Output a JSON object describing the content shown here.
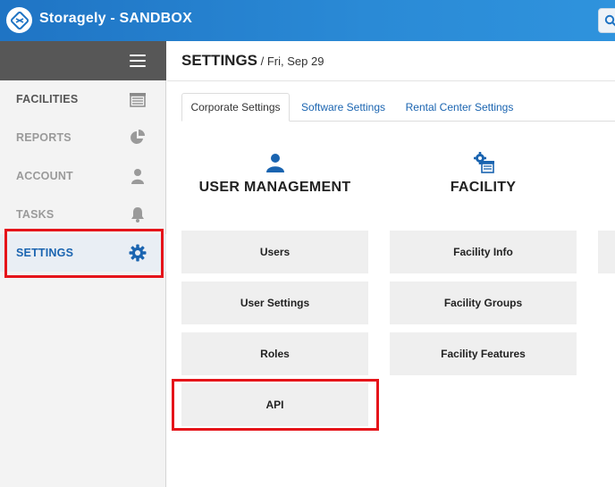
{
  "app": {
    "title": "Storagely - SANDBOX"
  },
  "sidebar": {
    "items": [
      {
        "label": "FACILITIES",
        "icon": "garage-icon",
        "color": "#555555"
      },
      {
        "label": "REPORTS",
        "icon": "pie-chart-icon",
        "color": "#9a9a9a"
      },
      {
        "label": "ACCOUNT",
        "icon": "user-icon",
        "color": "#9a9a9a"
      },
      {
        "label": "TASKS",
        "icon": "bell-icon",
        "color": "#9a9a9a"
      },
      {
        "label": "SETTINGS",
        "icon": "gear-icon",
        "color": "#1a64b0",
        "active": true
      }
    ]
  },
  "header": {
    "title": "SETTINGS",
    "subtitle": " / Fri, Sep 29"
  },
  "tabs": [
    {
      "label": "Corporate Settings",
      "active": true
    },
    {
      "label": "Software Settings"
    },
    {
      "label": "Rental Center Settings"
    }
  ],
  "sections": {
    "user_management": {
      "title": "USER MANAGEMENT",
      "tiles": [
        "Users",
        "User Settings",
        "Roles",
        "API"
      ]
    },
    "facility": {
      "title": "FACILITY",
      "tiles": [
        "Facility Info",
        "Facility Groups",
        "Facility Features"
      ]
    }
  },
  "colors": {
    "accent": "#1a64b0",
    "highlight": "#e5141a",
    "topbar": "#2a8ad6"
  }
}
